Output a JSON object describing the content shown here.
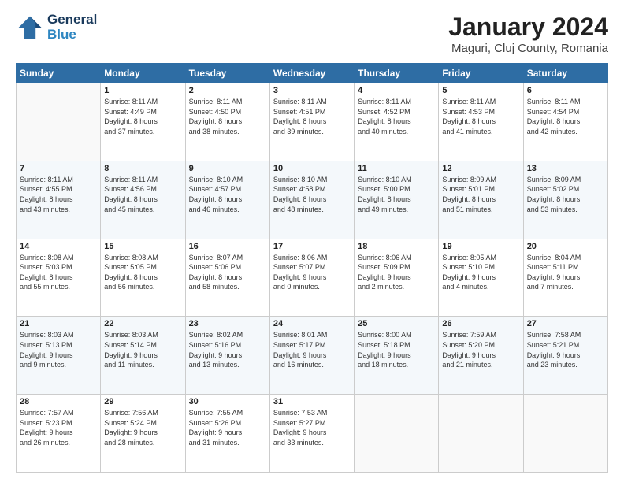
{
  "header": {
    "logo_line1": "General",
    "logo_line2": "Blue",
    "title": "January 2024",
    "subtitle": "Maguri, Cluj County, Romania"
  },
  "days_of_week": [
    "Sunday",
    "Monday",
    "Tuesday",
    "Wednesday",
    "Thursday",
    "Friday",
    "Saturday"
  ],
  "weeks": [
    [
      {
        "day": "",
        "info": ""
      },
      {
        "day": "1",
        "info": "Sunrise: 8:11 AM\nSunset: 4:49 PM\nDaylight: 8 hours\nand 37 minutes."
      },
      {
        "day": "2",
        "info": "Sunrise: 8:11 AM\nSunset: 4:50 PM\nDaylight: 8 hours\nand 38 minutes."
      },
      {
        "day": "3",
        "info": "Sunrise: 8:11 AM\nSunset: 4:51 PM\nDaylight: 8 hours\nand 39 minutes."
      },
      {
        "day": "4",
        "info": "Sunrise: 8:11 AM\nSunset: 4:52 PM\nDaylight: 8 hours\nand 40 minutes."
      },
      {
        "day": "5",
        "info": "Sunrise: 8:11 AM\nSunset: 4:53 PM\nDaylight: 8 hours\nand 41 minutes."
      },
      {
        "day": "6",
        "info": "Sunrise: 8:11 AM\nSunset: 4:54 PM\nDaylight: 8 hours\nand 42 minutes."
      }
    ],
    [
      {
        "day": "7",
        "info": "Sunrise: 8:11 AM\nSunset: 4:55 PM\nDaylight: 8 hours\nand 43 minutes."
      },
      {
        "day": "8",
        "info": "Sunrise: 8:11 AM\nSunset: 4:56 PM\nDaylight: 8 hours\nand 45 minutes."
      },
      {
        "day": "9",
        "info": "Sunrise: 8:10 AM\nSunset: 4:57 PM\nDaylight: 8 hours\nand 46 minutes."
      },
      {
        "day": "10",
        "info": "Sunrise: 8:10 AM\nSunset: 4:58 PM\nDaylight: 8 hours\nand 48 minutes."
      },
      {
        "day": "11",
        "info": "Sunrise: 8:10 AM\nSunset: 5:00 PM\nDaylight: 8 hours\nand 49 minutes."
      },
      {
        "day": "12",
        "info": "Sunrise: 8:09 AM\nSunset: 5:01 PM\nDaylight: 8 hours\nand 51 minutes."
      },
      {
        "day": "13",
        "info": "Sunrise: 8:09 AM\nSunset: 5:02 PM\nDaylight: 8 hours\nand 53 minutes."
      }
    ],
    [
      {
        "day": "14",
        "info": "Sunrise: 8:08 AM\nSunset: 5:03 PM\nDaylight: 8 hours\nand 55 minutes."
      },
      {
        "day": "15",
        "info": "Sunrise: 8:08 AM\nSunset: 5:05 PM\nDaylight: 8 hours\nand 56 minutes."
      },
      {
        "day": "16",
        "info": "Sunrise: 8:07 AM\nSunset: 5:06 PM\nDaylight: 8 hours\nand 58 minutes."
      },
      {
        "day": "17",
        "info": "Sunrise: 8:06 AM\nSunset: 5:07 PM\nDaylight: 9 hours\nand 0 minutes."
      },
      {
        "day": "18",
        "info": "Sunrise: 8:06 AM\nSunset: 5:09 PM\nDaylight: 9 hours\nand 2 minutes."
      },
      {
        "day": "19",
        "info": "Sunrise: 8:05 AM\nSunset: 5:10 PM\nDaylight: 9 hours\nand 4 minutes."
      },
      {
        "day": "20",
        "info": "Sunrise: 8:04 AM\nSunset: 5:11 PM\nDaylight: 9 hours\nand 7 minutes."
      }
    ],
    [
      {
        "day": "21",
        "info": "Sunrise: 8:03 AM\nSunset: 5:13 PM\nDaylight: 9 hours\nand 9 minutes."
      },
      {
        "day": "22",
        "info": "Sunrise: 8:03 AM\nSunset: 5:14 PM\nDaylight: 9 hours\nand 11 minutes."
      },
      {
        "day": "23",
        "info": "Sunrise: 8:02 AM\nSunset: 5:16 PM\nDaylight: 9 hours\nand 13 minutes."
      },
      {
        "day": "24",
        "info": "Sunrise: 8:01 AM\nSunset: 5:17 PM\nDaylight: 9 hours\nand 16 minutes."
      },
      {
        "day": "25",
        "info": "Sunrise: 8:00 AM\nSunset: 5:18 PM\nDaylight: 9 hours\nand 18 minutes."
      },
      {
        "day": "26",
        "info": "Sunrise: 7:59 AM\nSunset: 5:20 PM\nDaylight: 9 hours\nand 21 minutes."
      },
      {
        "day": "27",
        "info": "Sunrise: 7:58 AM\nSunset: 5:21 PM\nDaylight: 9 hours\nand 23 minutes."
      }
    ],
    [
      {
        "day": "28",
        "info": "Sunrise: 7:57 AM\nSunset: 5:23 PM\nDaylight: 9 hours\nand 26 minutes."
      },
      {
        "day": "29",
        "info": "Sunrise: 7:56 AM\nSunset: 5:24 PM\nDaylight: 9 hours\nand 28 minutes."
      },
      {
        "day": "30",
        "info": "Sunrise: 7:55 AM\nSunset: 5:26 PM\nDaylight: 9 hours\nand 31 minutes."
      },
      {
        "day": "31",
        "info": "Sunrise: 7:53 AM\nSunset: 5:27 PM\nDaylight: 9 hours\nand 33 minutes."
      },
      {
        "day": "",
        "info": ""
      },
      {
        "day": "",
        "info": ""
      },
      {
        "day": "",
        "info": ""
      }
    ]
  ]
}
